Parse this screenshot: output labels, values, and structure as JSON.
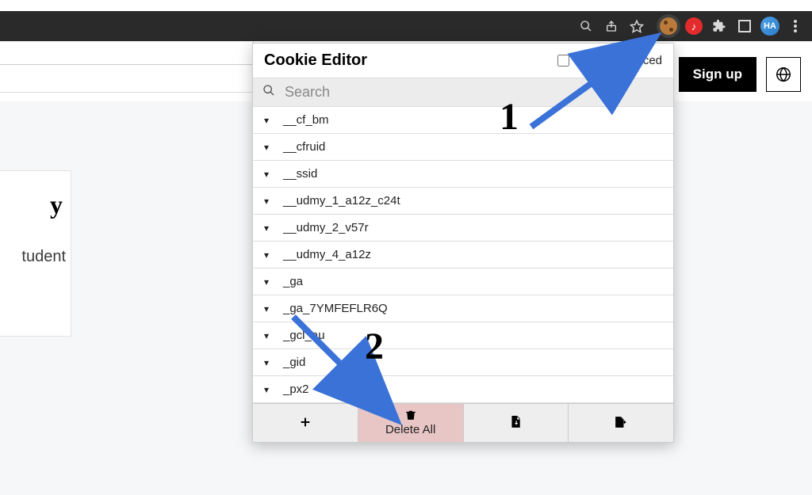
{
  "browser": {
    "avatar_initials": "HA"
  },
  "page": {
    "heading_fragment": "y",
    "subtext_fragment": "tudent"
  },
  "auth": {
    "signup_label": "Sign up"
  },
  "popup": {
    "title": "Cookie Editor",
    "advanced_label": "Show Advanced",
    "search_placeholder": "Search",
    "cookies": [
      "__cf_bm",
      "__cfruid",
      "__ssid",
      "__udmy_1_a12z_c24t",
      "__udmy_2_v57r",
      "__udmy_4_a12z",
      "_ga",
      "_ga_7YMFEFLR6Q",
      "_gcl_au",
      "_gid",
      "_px2"
    ],
    "footer": {
      "add_label": "",
      "delete_label": "Delete All",
      "import_label": "",
      "export_label": ""
    }
  },
  "annotations": {
    "one": "1",
    "two": "2"
  }
}
